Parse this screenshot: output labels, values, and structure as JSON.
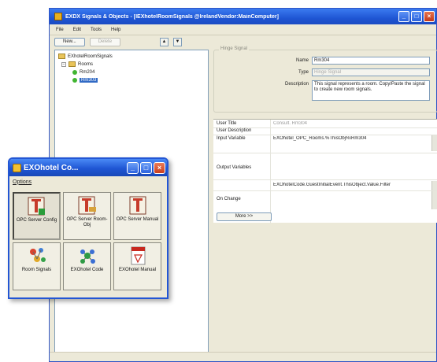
{
  "main_window": {
    "title": "EXDX Signals & Objects - [IEXhotelRoomSignals @IrelandVendor:MainComputer]",
    "menu": [
      "File",
      "Edit",
      "Tools",
      "Help"
    ],
    "toolbar": {
      "new_label": "New...",
      "delete_label": "Delete"
    },
    "tree": {
      "root": "EXhotelRoomSignals",
      "folder": "Rooms",
      "items": [
        "Rm204",
        "Rm303"
      ],
      "selected": "Rm303"
    },
    "group_label": "Hinge Signal",
    "fields": {
      "name_label": "Name",
      "name_value": "Rm304",
      "type_label": "Type",
      "type_value": "Hinge Signal",
      "description_label": "Description",
      "description_value": "This signal represents a room. Copy/Paste the signal to create new room signals."
    },
    "properties": [
      {
        "label": "User Title",
        "value": "Consult. Rm304"
      },
      {
        "label": "User Description",
        "value": ""
      },
      {
        "label": "Input Variable",
        "value": "EXOhotel_OPC_Rooms.%ThisObj%\\Rm304"
      },
      {
        "label": "Output Variables",
        "value": ""
      },
      {
        "label": "",
        "value": "EXOhotelCode.GuestInitialEvent.ThisObject.Value.Filter"
      },
      {
        "label": "On Change",
        "value": ""
      }
    ],
    "more_button": "More >>"
  },
  "launcher": {
    "title": "EXOhotel Co...",
    "menu": "Options",
    "tiles": [
      {
        "label": "OPC Server Config",
        "icon": "opc-config-icon",
        "pressed": true
      },
      {
        "label": "OPC Server Room-Obj",
        "icon": "opc-room-icon",
        "pressed": false
      },
      {
        "label": "OPC Server Manual",
        "icon": "opc-manual-icon",
        "pressed": false
      },
      {
        "label": "Room Signals",
        "icon": "room-signals-icon",
        "pressed": false
      },
      {
        "label": "EXOhotel Code",
        "icon": "code-molecule-icon",
        "pressed": false
      },
      {
        "label": "EXOhotel Manual",
        "icon": "pdf-manual-icon",
        "pressed": false
      }
    ]
  },
  "colors": {
    "titlebar_blue": "#1f56d4",
    "selection": "#316ac5",
    "tree_dot": "#41b531",
    "window_bg": "#ece9d8"
  }
}
